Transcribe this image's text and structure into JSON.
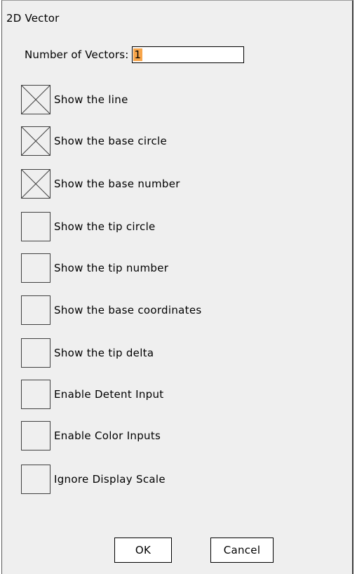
{
  "dialog": {
    "title": "2D Vector",
    "vectors_label": "Number of Vectors:",
    "vectors_value": "1",
    "options": [
      {
        "label": "Show the line",
        "checked": true
      },
      {
        "label": "Show the base circle",
        "checked": true
      },
      {
        "label": "Show the base number",
        "checked": true
      },
      {
        "label": "Show the tip circle",
        "checked": false
      },
      {
        "label": "Show the tip number",
        "checked": false
      },
      {
        "label": "Show the base coordinates",
        "checked": false
      },
      {
        "label": "Show the tip delta",
        "checked": false
      },
      {
        "label": "Enable Detent Input",
        "checked": false
      },
      {
        "label": "Enable Color Inputs",
        "checked": false
      },
      {
        "label": "Ignore Display Scale",
        "checked": false
      }
    ],
    "ok_label": "OK",
    "cancel_label": "Cancel"
  },
  "colors": {
    "background": "#efefef",
    "input_highlight": "#f7a54a"
  }
}
